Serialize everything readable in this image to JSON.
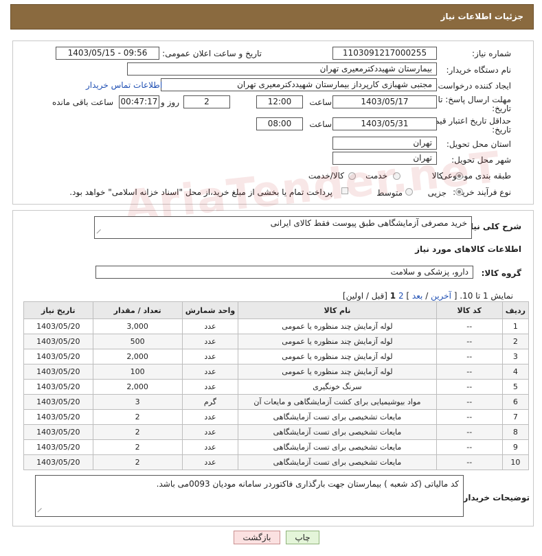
{
  "header": {
    "title": "جزئیات اطلاعات نیاز"
  },
  "form": {
    "need_number_label": "شماره نیاز:",
    "need_number": "1103091217000255",
    "announce_label": "تاریخ و ساعت اعلان عمومی:",
    "announce_value": "1403/05/15 - 09:56",
    "buyer_label": "نام دستگاه خریدار:",
    "buyer_value": "بیمارستان شهیدد‌کترمعیری تهران",
    "requester_label": "ایجاد کننده درخواست:",
    "requester_value": "مجتبی  شهبازی کارپرداز بیمارستان شهیددکترمعیری تهران",
    "contact_link": "اطلاعات تماس خریدار",
    "deadline_label_1": "مهلت ارسال پاسخ: تا",
    "deadline_label_2": "تاریخ:",
    "deadline_date": "1403/05/17",
    "time_label": "ساعت",
    "deadline_time": "12:00",
    "days_value": "2",
    "days_label": "روز و",
    "remaining_value": "00:47:17",
    "remaining_label": "ساعت باقی مانده",
    "validity_label_1": "حداقل تاریخ اعتبار قیمت: تا",
    "validity_label_2": "تاریخ:",
    "validity_date": "1403/05/31",
    "validity_time": "08:00",
    "province_label": "استان محل تحویل:",
    "province_value": "تهران",
    "city_label": "شهر محل تحویل:",
    "city_value": "تهران",
    "category_label": "طبقه بندی موضوعی:",
    "category_options": [
      "کالا",
      "خدمت",
      "کالا/خدمت"
    ],
    "process_label": "نوع فرآیند خرید :",
    "process_options": [
      "جزیی",
      "متوسط"
    ],
    "payment_note": "پرداخت تمام یا بخشی از مبلغ خرید،از محل \"اسناد خزانه اسلامی\" خواهد بود."
  },
  "summary": {
    "label": "شرح کلی نیاز:",
    "value": "خرید مصرفی آزمایشگاهی طبق پیوست فقط کالای ایرانی"
  },
  "goods": {
    "section_title": "اطلاعات کالاهای مورد نیاز",
    "group_label": "گروه کالا:",
    "group_value": "دارو، پزشکی و سلامت",
    "paging": {
      "prefix": "نمایش 1 تا 10. [",
      "last": "آخرین",
      "sep": "/",
      "next": "بعد",
      "close": "]",
      "pages_prefix": "2",
      "current": "1",
      "suffix": "[قبل / اولین]"
    },
    "columns": [
      "ردیف",
      "کد کالا",
      "نام کالا",
      "واحد شمارش",
      "تعداد / مقدار",
      "تاریخ نیاز"
    ],
    "rows": [
      {
        "idx": "1",
        "code": "--",
        "name": "لوله آزمایش چند منظوره یا عمومی",
        "unit": "عدد",
        "qty": "3,000",
        "date": "1403/05/20"
      },
      {
        "idx": "2",
        "code": "--",
        "name": "لوله آزمایش چند منظوره یا عمومی",
        "unit": "عدد",
        "qty": "500",
        "date": "1403/05/20"
      },
      {
        "idx": "3",
        "code": "--",
        "name": "لوله آزمایش چند منظوره یا عمومی",
        "unit": "عدد",
        "qty": "2,000",
        "date": "1403/05/20"
      },
      {
        "idx": "4",
        "code": "--",
        "name": "لوله آزمایش چند منظوره یا عمومی",
        "unit": "عدد",
        "qty": "100",
        "date": "1403/05/20"
      },
      {
        "idx": "5",
        "code": "--",
        "name": "سرنگ خونگیری",
        "unit": "عدد",
        "qty": "2,000",
        "date": "1403/05/20"
      },
      {
        "idx": "6",
        "code": "--",
        "name": "مواد بیوشیمیایی برای کشت آزمایشگاهی و مایعات آن",
        "unit": "گرم",
        "qty": "3",
        "date": "1403/05/20"
      },
      {
        "idx": "7",
        "code": "--",
        "name": "مایعات تشخیصی برای تست آزمایشگاهی",
        "unit": "عدد",
        "qty": "2",
        "date": "1403/05/20"
      },
      {
        "idx": "8",
        "code": "--",
        "name": "مایعات تشخیصی برای تست آزمایشگاهی",
        "unit": "عدد",
        "qty": "2",
        "date": "1403/05/20"
      },
      {
        "idx": "9",
        "code": "--",
        "name": "مایعات تشخیصی برای تست آزمایشگاهی",
        "unit": "عدد",
        "qty": "2",
        "date": "1403/05/20"
      },
      {
        "idx": "10",
        "code": "--",
        "name": "مایعات تشخیصی برای تست آزمایشگاهی",
        "unit": "عدد",
        "qty": "2",
        "date": "1403/05/20"
      }
    ]
  },
  "notes": {
    "label": "توضیحات خریدار:",
    "value": "کد مالیاتی (کد شعبه ) بیمارستان جهت بارگذاری فاکتوردر سامانه مودیان 0093می باشد."
  },
  "buttons": {
    "print": "چاپ",
    "back": "بازگشت"
  },
  "watermark": "AriaTender.neT"
}
